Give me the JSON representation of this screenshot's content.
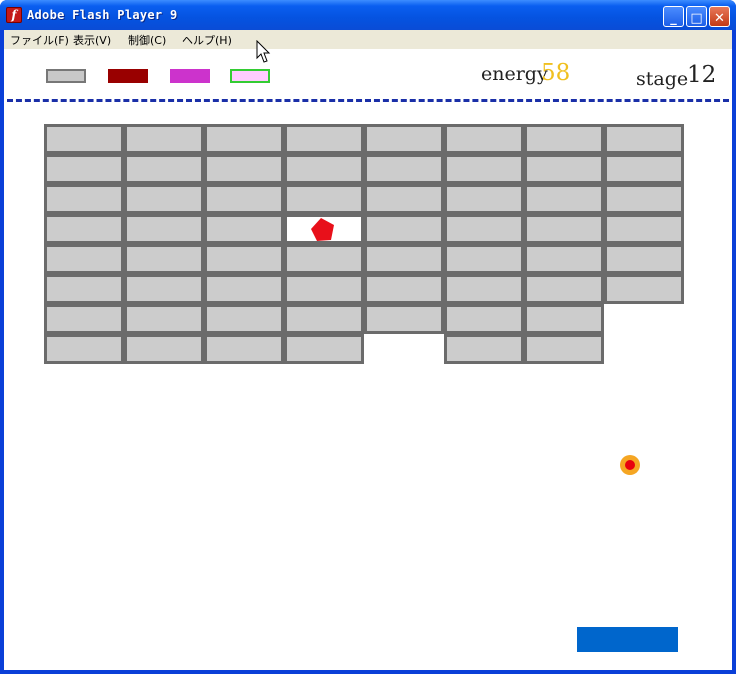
{
  "window": {
    "title": "Adobe Flash Player 9",
    "app_icon": "flash-icon",
    "controls": {
      "minimize_icon": "minimize-icon",
      "maximize_icon": "maximize-icon",
      "close_icon": "close-icon"
    }
  },
  "menubar": {
    "items": [
      {
        "label": "ファイル(F)"
      },
      {
        "label": "表示(V)"
      },
      {
        "label": "制御(C)"
      },
      {
        "label": "ヘルプ(H)"
      }
    ]
  },
  "hud": {
    "legend_bricks": [
      {
        "name": "gray",
        "fill": "#c8c8c8",
        "border": "#777777"
      },
      {
        "name": "dark-red",
        "fill": "#990000",
        "border": "#990000"
      },
      {
        "name": "magenta",
        "fill": "#cc33cc",
        "border": "#cc33cc"
      },
      {
        "name": "pink",
        "fill": "#ffccff",
        "border": "#33cc33"
      }
    ],
    "energy_label": "energy",
    "energy_value": "58",
    "stage_label": "stage",
    "stage_value": "12"
  },
  "colors": {
    "divider": "#1a2fa8",
    "brick_fill": "#cccccc",
    "brick_border": "#6b6b6b",
    "paddle": "#0066cc",
    "ball_outer": "#f5a623",
    "ball_inner": "#e8000e",
    "enemy": "#e8101a",
    "energy_value": "#f0c020"
  },
  "bricks": {
    "columns": 8,
    "rows": [
      [
        "b",
        "b",
        "b",
        "b",
        "b",
        "b",
        "b",
        "b"
      ],
      [
        "b",
        "b",
        "b",
        "b",
        "b",
        "b",
        "b",
        "b"
      ],
      [
        "b",
        "b",
        "b",
        "b",
        "b",
        "b",
        "b",
        "b"
      ],
      [
        "b",
        "b",
        "b",
        "e",
        "b",
        "b",
        "b",
        "b"
      ],
      [
        "b",
        "b",
        "b",
        "b",
        "b",
        "b",
        "b",
        "b"
      ],
      [
        "b",
        "b",
        "b",
        "b",
        "b",
        "b",
        "b",
        "b"
      ],
      [
        "b",
        "b",
        "b",
        "b",
        "b",
        "b",
        "b",
        "-"
      ],
      [
        "b",
        "b",
        "b",
        "b",
        "-",
        "b",
        "b",
        "-"
      ]
    ]
  },
  "enemy": {
    "shape": "pentagon-icon"
  },
  "ball": {
    "shape": "ball-icon"
  },
  "paddle": {
    "shape": "paddle"
  }
}
